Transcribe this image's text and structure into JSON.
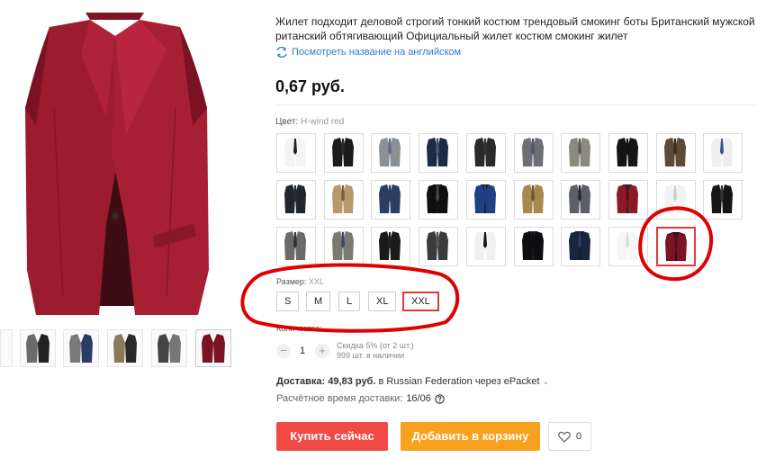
{
  "product": {
    "title_line1": "Жилет подходит деловой строгий тонкий костюм трендовый смокинг боты Британский мужской боты Б",
    "title_line2": "ританский обтягивающий Официальный жилет костюм смокинг жилет",
    "translate_link": "Посмотреть название на английском",
    "price": "0,67 руб."
  },
  "color": {
    "label": "Цвет:",
    "selected": "H-wind red",
    "swatches": [
      {
        "vest": "#f4f4f4",
        "shirt": "#ffffff",
        "tie": "#222222"
      },
      {
        "vest": "#1b1b1d",
        "shirt": "#ffffff",
        "tie": "#2b2b2b"
      },
      {
        "vest": "#8b8f96",
        "shirt": "#e8edf3",
        "tie": "#5a6f90"
      },
      {
        "vest": "#1f2a44",
        "shirt": "#cfdceb",
        "tie": "#44577a"
      },
      {
        "vest": "#2a2a2a",
        "shirt": "#f2f2f2",
        "tie": "#333333"
      },
      {
        "vest": "#6e6f73",
        "shirt": "#dfe7ef",
        "tie": "#4a5570"
      },
      {
        "vest": "#8a8a7e",
        "shirt": "#eaeaea",
        "tie": "#5e5e55"
      },
      {
        "vest": "#151515",
        "shirt": "#ffffff",
        "tie": "#111111"
      },
      {
        "vest": "#5b4b37",
        "shirt": "#ece6dc",
        "tie": "#3a2f22"
      },
      {
        "vest": "#eeeeee",
        "shirt": "#ffffff",
        "tie": "#3a4f86"
      },
      {
        "vest": "#202530",
        "shirt": "#ffffff",
        "tie": "#2a2a2a"
      },
      {
        "vest": "#b8996c",
        "shirt": "#f4ede0",
        "tie": "#7b6240"
      },
      {
        "vest": "#2c3d63",
        "shirt": "#dce6f1",
        "tie": "#2c3d63"
      },
      {
        "vest": "#0f0f10",
        "shirt": "#1a1a1a",
        "tie": "#444444"
      },
      {
        "vest": "#1f3f86",
        "shirt": "#1b1b1b",
        "tie": "#1f3f86"
      },
      {
        "vest": "#a7884f",
        "shirt": "#f1e8d0",
        "tie": "#6e5a30"
      },
      {
        "vest": "#5c5f66",
        "shirt": "#e6eaef",
        "tie": "#2b2b2b"
      },
      {
        "vest": "#8b1a26",
        "shirt": "#222222",
        "tie": "#5c0f18"
      },
      {
        "vest": "#f2f2f2",
        "shirt": "#ffffff",
        "tie": "#cfcfcf"
      },
      {
        "vest": "#151515",
        "shirt": "#ffffff",
        "tie": "#333333"
      },
      {
        "vest": "#6a6a6a",
        "shirt": "#ffffff",
        "tie": "#333333"
      },
      {
        "vest": "#7c7a70",
        "shirt": "#d9e2ec",
        "tie": "#3b4a63"
      },
      {
        "vest": "#1a1a1a",
        "shirt": "#ffffff",
        "tie": "#222222"
      },
      {
        "vest": "#3b3b3b",
        "shirt": "#e9e9e9",
        "tie": "#555555"
      },
      {
        "vest": "#f0f0f0",
        "shirt": "#ffffff",
        "tie": "#111111"
      },
      {
        "vest": "#0e0e12",
        "shirt": "#222222",
        "tie": "#0e0e12"
      },
      {
        "vest": "#1a2540",
        "shirt": "#1a1a1a",
        "tie": "#2a3a60"
      },
      {
        "vest": "#f6f6f6",
        "shirt": "#ffffff",
        "tie": "#dddddd"
      },
      {
        "vest": "#7a1323",
        "shirt": "#2a0c11",
        "tie": "#5a0e19"
      }
    ]
  },
  "size": {
    "label": "Размер:",
    "selected": "XXL",
    "options": [
      "S",
      "M",
      "L",
      "XL",
      "XXL"
    ]
  },
  "quantity": {
    "label": "Количество:",
    "minus": "−",
    "plus": "+",
    "value": "1",
    "discount": "Скидка 5% (от 2 шт.)",
    "available": "999 шт. в наличии"
  },
  "delivery": {
    "label": "Доставка:",
    "cost": "49,83 руб.",
    "text": "в Russian Federation через ePacket",
    "caret": "⌄",
    "eta_label": "Расчётное время доставки:",
    "eta_value": "16/06"
  },
  "actions": {
    "buy_now": "Купить сейчас",
    "add_to_cart": "Добавить в корзину",
    "wishlist_count": "0"
  },
  "colors": {
    "accent_red": "#ef4a43",
    "accent_orange": "#f8a11f",
    "annotation_red": "#e00000",
    "link_blue": "#2e7ad1"
  }
}
